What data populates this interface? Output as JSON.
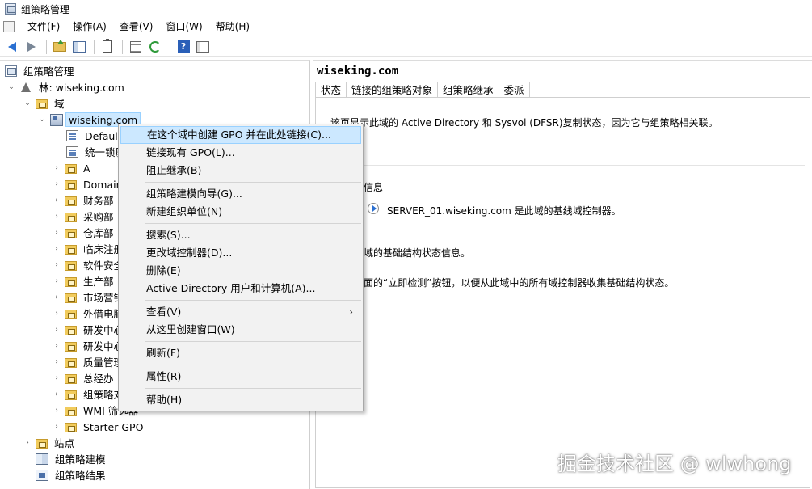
{
  "window": {
    "title": "组策略管理"
  },
  "menubar": {
    "items": [
      "文件(F)",
      "操作(A)",
      "查看(V)",
      "窗口(W)",
      "帮助(H)"
    ]
  },
  "toolbar": {
    "icons": [
      "back-arrow-icon",
      "forward-arrow-icon",
      "folder-up-icon",
      "show-hide-tree-icon",
      "clipboard-icon",
      "properties-icon",
      "refresh-icon",
      "help-icon",
      "view-icon"
    ],
    "help_glyph": "?"
  },
  "tree": {
    "root": "组策略管理",
    "forest": "林: wiseking.com",
    "domains": "域",
    "domain": "wiseking.com",
    "items": [
      "Default",
      "统一锁屏",
      "A",
      "Domain",
      "财务部",
      "采购部",
      "仓库部",
      "临床注册",
      "软件安全",
      "生产部",
      "市场营销",
      "外借电脑",
      "研发中心",
      "研发中心",
      "质量管理",
      "总经办",
      "组策略对象",
      "WMI 筛选器",
      "Starter GPO"
    ],
    "sites": "站点",
    "modeling": "组策略建模",
    "results": "组策略结果"
  },
  "context_menu": {
    "items": [
      "在这个域中创建 GPO 并在此处链接(C)...",
      "链接现有 GPO(L)...",
      "阻止继承(B)",
      "组策略建模向导(G)...",
      "新建组织单位(N)",
      "搜索(S)...",
      "更改域控制器(D)...",
      "删除(E)",
      "Active Directory 用户和计算机(A)...",
      "查看(V)",
      "从这里创建窗口(W)",
      "刷新(F)",
      "属性(R)",
      "帮助(H)"
    ],
    "submenu_arrow": "›"
  },
  "right_pane": {
    "title": "wiseking.com",
    "tabs": [
      "状态",
      "链接的组策略对象",
      "组策略继承",
      "委派"
    ],
    "description": "该页显示此域的 Active Directory 和 Sysvol (DFSR)复制状态，因为它与组策略相关联。",
    "details_heading": "细信息",
    "baseline_dc": "SERVER_01.wiseking.com 是此域的基线域控制器。",
    "infra_info": "此域的基础结构状态信息。",
    "detect_hint": "下面的“立即检测”按钮，以便从此域中的所有域控制器收集基础结构状态。"
  },
  "watermark": "掘金技术社区 @ wlwhong"
}
